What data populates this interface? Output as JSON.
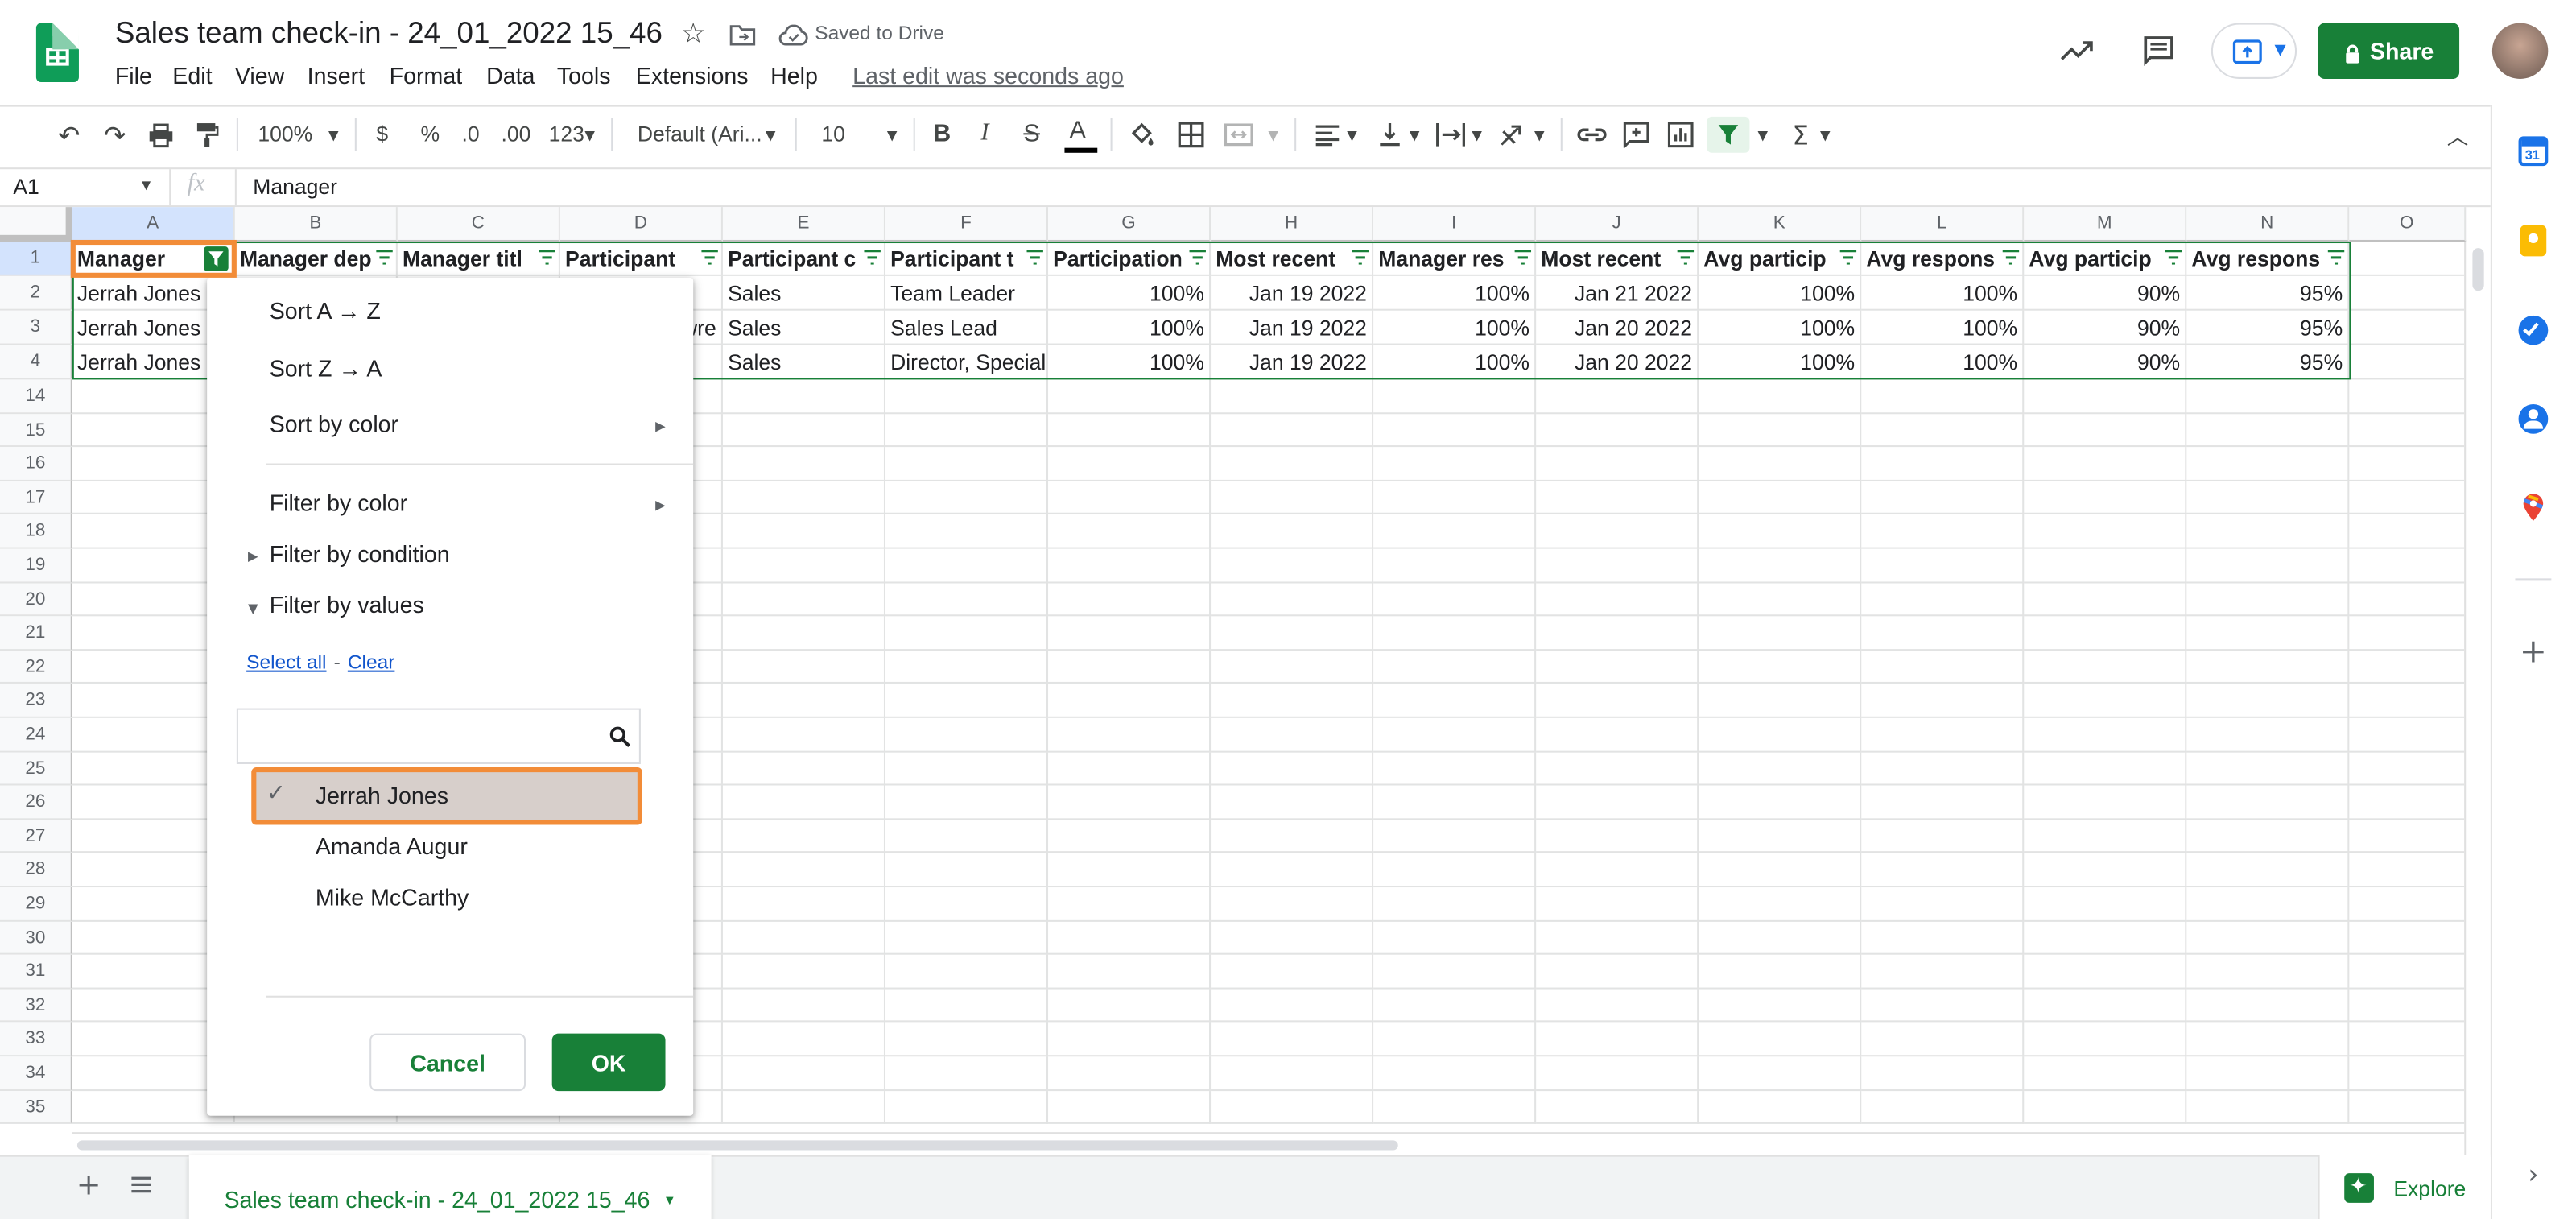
{
  "doc": {
    "title": "Sales team check-in - 24_01_2022 15_46",
    "saved": "Saved to Drive",
    "menus": [
      "File",
      "Edit",
      "View",
      "Insert",
      "Format",
      "Data",
      "Tools",
      "Extensions",
      "Help"
    ],
    "last_edit": "Last edit was seconds ago",
    "share": "Share"
  },
  "toolbar": {
    "zoom": "100%",
    "currency": "$",
    "percent": "%",
    "dec_dec": ".0",
    "dec_inc": ".00",
    "more_formats": "123",
    "font": "Default (Ari...",
    "size": "10",
    "bold": "B",
    "italic": "I",
    "strike": "S",
    "text_color": "A"
  },
  "formula_bar": {
    "cell_ref": "A1",
    "fx": "fx",
    "value": "Manager"
  },
  "grid": {
    "columns": [
      "A",
      "B",
      "C",
      "D",
      "E",
      "F",
      "G",
      "H",
      "I",
      "J",
      "K",
      "L",
      "M",
      "N",
      "O"
    ],
    "rows": [
      "1",
      "2",
      "3",
      "4",
      "14",
      "15",
      "16",
      "17",
      "18",
      "19",
      "20",
      "21",
      "22",
      "23",
      "24",
      "25",
      "26",
      "27",
      "28",
      "29",
      "30",
      "31",
      "32",
      "33",
      "34",
      "35"
    ],
    "header": [
      "Manager",
      "Manager dep",
      "Manager titl",
      "Participant",
      "Participant c",
      "Participant t",
      "Participation",
      "Most recent",
      "Manager res",
      "Most recent",
      "Avg particip",
      "Avg respons",
      "Avg particip",
      "Avg respons"
    ],
    "data": [
      [
        "Jerrah Jones",
        "",
        "",
        "",
        "Sales",
        "Team Leader",
        "100%",
        "Jan 19 2022",
        "100%",
        "Jan 21 2022",
        "100%",
        "100%",
        "90%",
        "95%"
      ],
      [
        "Jerrah Jones",
        "",
        "",
        "wre",
        "Sales",
        "Sales Lead",
        "100%",
        "Jan 19 2022",
        "100%",
        "Jan 20 2022",
        "100%",
        "100%",
        "90%",
        "95%"
      ],
      [
        "Jerrah Jones",
        "",
        "",
        "",
        "Sales",
        "Director, Special",
        "100%",
        "Jan 19 2022",
        "100%",
        "Jan 20 2022",
        "100%",
        "100%",
        "90%",
        "95%"
      ]
    ]
  },
  "filter_menu": {
    "sort_az": "Sort A → Z",
    "sort_za": "Sort Z → A",
    "sort_color": "Sort by color",
    "filter_color": "Filter by color",
    "filter_condition": "Filter by condition",
    "filter_values": "Filter by values",
    "select_all": "Select all",
    "dash": "-",
    "clear": "Clear",
    "values": [
      {
        "label": "Jerrah Jones",
        "checked": true
      },
      {
        "label": "Amanda Augur",
        "checked": false
      },
      {
        "label": "Mike McCarthy",
        "checked": false
      }
    ],
    "cancel": "Cancel",
    "ok": "OK"
  },
  "sheet_tab": "Sales team check-in - 24_01_2022 15_46",
  "explore": "Explore",
  "colors": {
    "accent": "#188038",
    "selection": "#d3e3fd",
    "highlight": "#f28c38"
  }
}
